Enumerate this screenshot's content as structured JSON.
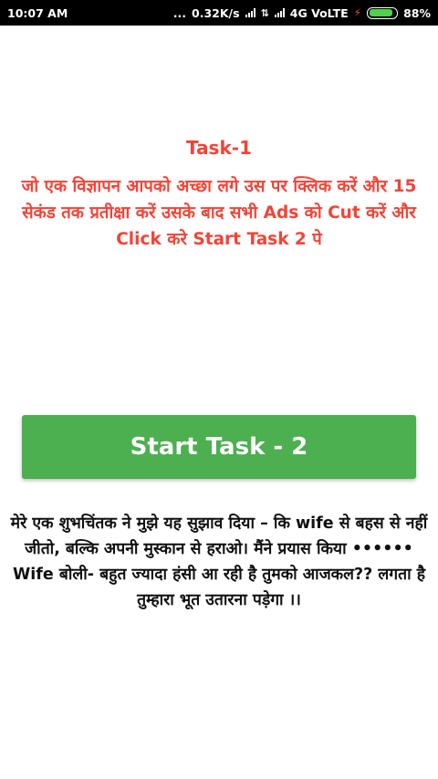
{
  "status_bar": {
    "time": "10:07 AM",
    "dots": "...",
    "speed": "0.32K/s",
    "network": "4G VoLTE",
    "battery": "88%",
    "battery_level": 0.88
  },
  "task": {
    "title": "Task-1",
    "description": "जो एक विज्ञापन आपको अच्छा लगे उस पर क्लिक करें और 15 सेकंड तक प्रतीक्षा करें उसके बाद सभी Ads को Cut करें और Click करे Start Task 2 पे"
  },
  "start_button": {
    "label": "Start Task - 2"
  },
  "quote": {
    "text": "मेरे एक शुभचिंतक ने मुझे यह सुझाव दिया – कि wife से बहस से नहीं जीतो, बल्कि अपनी मुस्कान से हराओ। मैंने प्रयास किया •••••• Wife बोली- बहुत ज्यादा हंसी आ रही है तुमको आजकल?? लगता है तुम्हारा भूत उतारना पड़ेगा ।।"
  },
  "colors": {
    "status_bar": "#000000",
    "task_text": "#f44336",
    "button": "#4caf50",
    "button_text": "#ffffff",
    "body_text": "#111111"
  }
}
